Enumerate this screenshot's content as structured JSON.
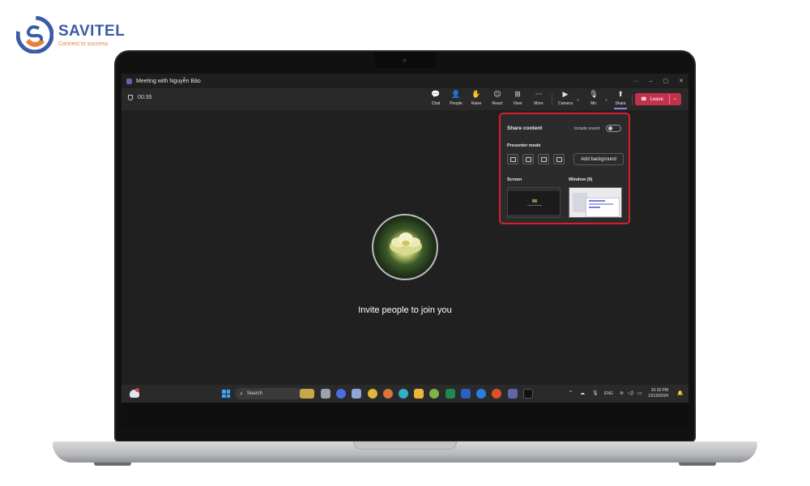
{
  "brand": {
    "name": "SAVITEL",
    "tagline": "Connect to success",
    "colors": {
      "name": "#3b5ba6",
      "accent": "#e8803a"
    }
  },
  "window": {
    "title": "Meeting with Nguyễn Bảo",
    "controls": [
      "···",
      "–",
      "▢",
      "✕"
    ]
  },
  "meeting": {
    "timer": "00:35",
    "toolbar": [
      {
        "icon": "chat-icon",
        "glyph": "💬",
        "label": "Chat"
      },
      {
        "icon": "people-icon",
        "glyph": "👤",
        "label": "People"
      },
      {
        "icon": "raise-hand-icon",
        "glyph": "✋",
        "label": "Raise"
      },
      {
        "icon": "react-icon",
        "glyph": "☺",
        "label": "React"
      },
      {
        "icon": "view-icon",
        "glyph": "⊞",
        "label": "View"
      },
      {
        "icon": "more-icon",
        "glyph": "···",
        "label": "More"
      },
      {
        "icon": "camera-off-icon",
        "glyph": "▶",
        "label": "Camera"
      },
      {
        "icon": "mic-off-icon",
        "glyph": "🎙",
        "label": "Mic"
      },
      {
        "icon": "share-icon",
        "glyph": "⬆",
        "label": "Share"
      }
    ],
    "leave_label": "Leave",
    "invite_text": "Invite people to join you",
    "accent": "#c4314b"
  },
  "share_panel": {
    "title": "Share content",
    "include_sound_label": "Include sound",
    "include_sound_on": false,
    "presenter_mode_label": "Presenter mode",
    "add_background_label": "Add background",
    "screen_label": "Screen",
    "window_label": "Window (9)",
    "highlight_color": "#d5202a"
  },
  "taskbar": {
    "search_label": "Search",
    "language": "ENG",
    "time": "10:16 PM",
    "date": "13/10/2024",
    "apps": [
      "file-explorer-icon",
      "photos-icon",
      "copilot-icon",
      "gallery-icon",
      "chrome-icon",
      "chrome-icon",
      "edge-icon",
      "folder-icon",
      "chrome-icon",
      "excel-icon",
      "word-icon",
      "zalo-icon",
      "media-icon",
      "teams-icon",
      "tiktok-icon"
    ]
  }
}
